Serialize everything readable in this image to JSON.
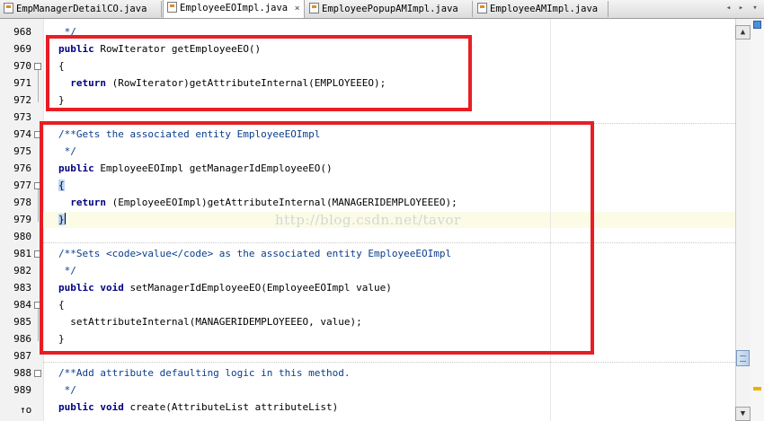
{
  "tabs": [
    {
      "label": "EmpManagerDetailCO.java",
      "active": false
    },
    {
      "label": "EmployeeEOImpl.java",
      "active": true
    },
    {
      "label": "EmployeePopupAMImpl.java",
      "active": false
    },
    {
      "label": "EmployeeAMImpl.java",
      "active": false
    }
  ],
  "icons": {
    "java_file": "java-file-icon",
    "close": "close-icon",
    "scroll_left": "chevron-left-icon",
    "scroll_right": "chevron-right-icon",
    "tab_menu": "chevron-down-icon",
    "fold": "fold-icon",
    "override": "override-up-arrow-icon"
  },
  "glyphs": {
    "close": "×",
    "left": "◂",
    "right": "▸",
    "menu": "▾",
    "scroll_up": "▲",
    "scroll_down": "▼",
    "fold": "−",
    "override": "↑o"
  },
  "editor": {
    "lines": [
      {
        "num": "968",
        "text": " */"
      },
      {
        "num": "969",
        "text": "public RowIterator getEmployeeEO()"
      },
      {
        "num": "970",
        "text": "{"
      },
      {
        "num": "971",
        "text": "  return (RowIterator)getAttributeInternal(EMPLOYEEEO);"
      },
      {
        "num": "972",
        "text": "}"
      },
      {
        "num": "973",
        "text": ""
      },
      {
        "num": "974",
        "text": "/**Gets the associated entity EmployeeEOImpl"
      },
      {
        "num": "975",
        "text": " */"
      },
      {
        "num": "976",
        "text": "public EmployeeEOImpl getManagerIdEmployeeEO()"
      },
      {
        "num": "977",
        "text": "{"
      },
      {
        "num": "978",
        "text": "  return (EmployeeEOImpl)getAttributeInternal(MANAGERIDEMPLOYEEEO);"
      },
      {
        "num": "979",
        "text": "}"
      },
      {
        "num": "980",
        "text": ""
      },
      {
        "num": "981",
        "text": "/**Sets <code>value</code> as the associated entity EmployeeEOImpl"
      },
      {
        "num": "982",
        "text": " */"
      },
      {
        "num": "983",
        "text": "public void setManagerIdEmployeeEO(EmployeeEOImpl value)"
      },
      {
        "num": "984",
        "text": "{"
      },
      {
        "num": "985",
        "text": "  setAttributeInternal(MANAGERIDEMPLOYEEEO, value);"
      },
      {
        "num": "986",
        "text": "}"
      },
      {
        "num": "987",
        "text": ""
      },
      {
        "num": "988",
        "text": "/**Add attribute defaulting logic in this method."
      },
      {
        "num": "989",
        "text": " */"
      },
      {
        "num": "",
        "text": "public void create(AttributeList attributeList)"
      }
    ],
    "watermark": "http://blog.csdn.net/tavor"
  },
  "colors": {
    "highlight_box": "#e81e24",
    "keyword": "#000080",
    "comment": "#0a3d8c"
  }
}
